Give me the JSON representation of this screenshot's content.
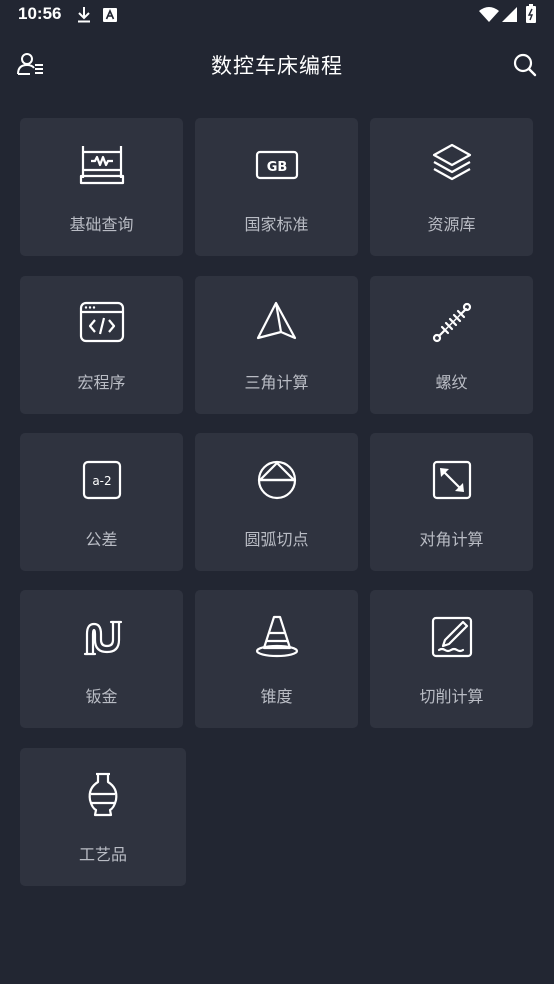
{
  "status_bar": {
    "time": "10:56",
    "icons": [
      "download-icon",
      "a-badge-icon",
      "wifi-icon",
      "signal-icon",
      "battery-icon"
    ]
  },
  "app_bar": {
    "title": "数控车床编程",
    "left_icon": "user-list-icon",
    "right_icon": "search-icon"
  },
  "grid": {
    "items": [
      {
        "label": "基础查询",
        "icon": "abacus-icon"
      },
      {
        "label": "国家标准",
        "icon": "gb-icon"
      },
      {
        "label": "资源库",
        "icon": "layers-icon"
      },
      {
        "label": "宏程序",
        "icon": "code-window-icon"
      },
      {
        "label": "三角计算",
        "icon": "pyramid-icon"
      },
      {
        "label": "螺纹",
        "icon": "spring-icon"
      },
      {
        "label": "公差",
        "icon": "a-minus-2-icon"
      },
      {
        "label": "圆弧切点",
        "icon": "circle-triangle-icon"
      },
      {
        "label": "对角计算",
        "icon": "diagonal-arrow-icon"
      },
      {
        "label": "钣金",
        "icon": "bent-pipe-icon"
      },
      {
        "label": "锥度",
        "icon": "traffic-cone-icon"
      },
      {
        "label": "切削计算",
        "icon": "cutting-tool-icon"
      },
      {
        "label": "工艺品",
        "icon": "vase-icon"
      }
    ]
  },
  "colors": {
    "background": "#222632",
    "card": "#2f333f",
    "label": "#b9bcc4",
    "icon": "#ffffff"
  }
}
